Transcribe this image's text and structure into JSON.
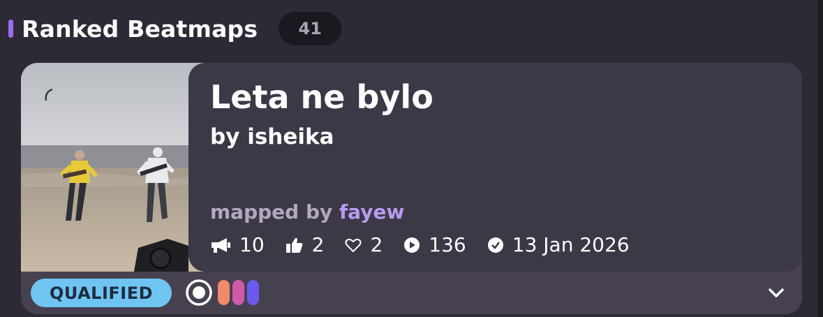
{
  "section": {
    "title": "Ranked Beatmaps",
    "count": "41",
    "accent_color": "#9b6cf0"
  },
  "beatmap": {
    "title": "Leta ne bylo",
    "artist": "by isheika",
    "mapped_by_prefix": "mapped by",
    "mapper": "fayew",
    "stats": {
      "hype": "10",
      "nominations": "2",
      "favourites": "2",
      "plays": "136",
      "date": "13 Jan 2026"
    },
    "status": "QUALIFIED",
    "status_color": "#6fc4f2",
    "mode_icon": "osu-standard-icon",
    "difficulty_colors": [
      "#f08a6a",
      "#d05aa8",
      "#6a5af0"
    ]
  }
}
